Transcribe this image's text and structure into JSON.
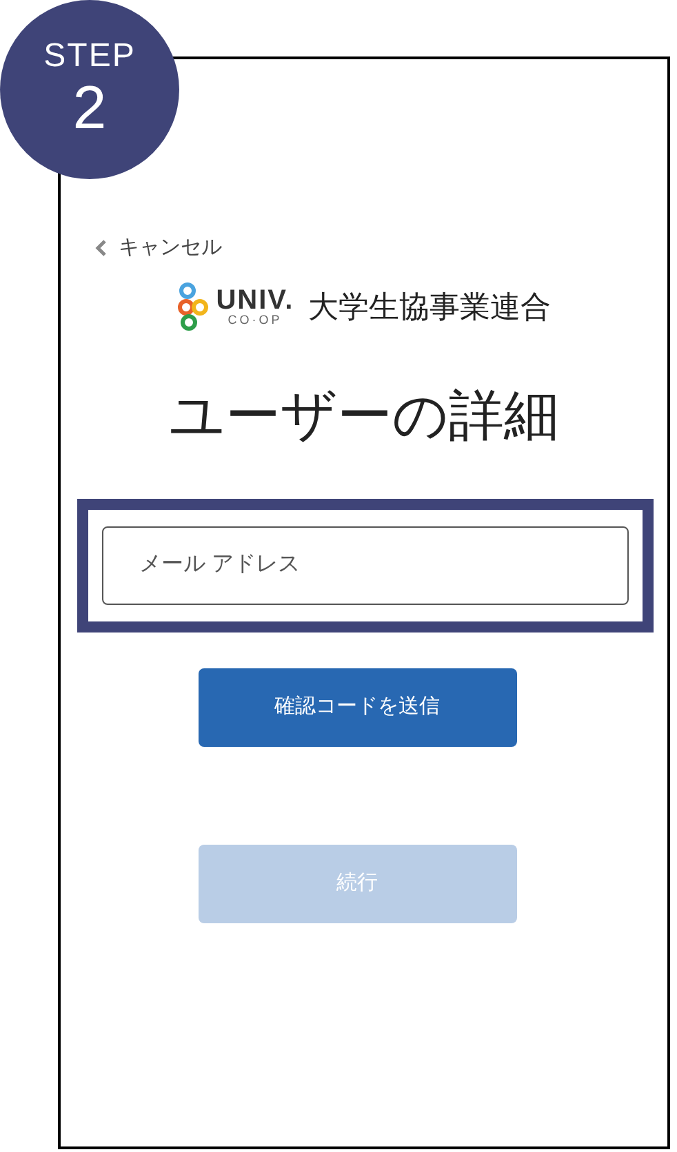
{
  "step": {
    "label": "STEP",
    "number": "2"
  },
  "cancel_link": {
    "label": "キャンセル"
  },
  "logo": {
    "wordmark": "UNIV.",
    "subword": "CO·OP",
    "organization": "大学生協事業連合"
  },
  "title": "ユーザーの詳細",
  "email_field": {
    "placeholder": "メール アドレス",
    "highlighted": true
  },
  "buttons": [
    {
      "label": "確認コードを送信",
      "disabled": false
    },
    {
      "label": "続行",
      "disabled": true
    }
  ]
}
